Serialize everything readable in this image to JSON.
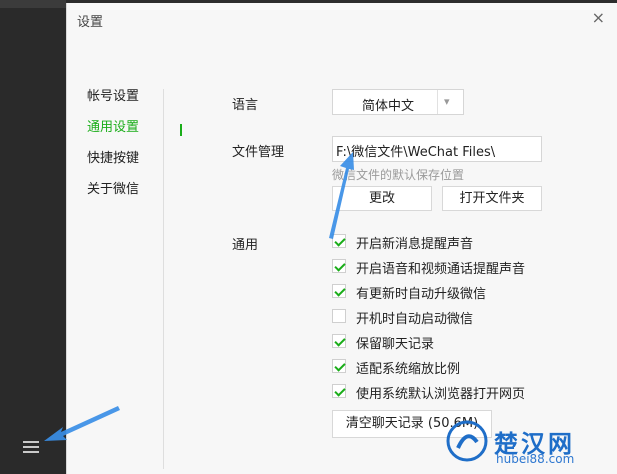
{
  "window": {
    "title": "设置",
    "close_glyph": "×"
  },
  "nav": {
    "items": [
      {
        "label": "帐号设置"
      },
      {
        "label": "通用设置"
      },
      {
        "label": "快捷按键"
      },
      {
        "label": "关于微信"
      }
    ],
    "active_color": "#1aad19"
  },
  "language": {
    "label": "语言",
    "value": "简体中文",
    "dropdown_glyph": "▾"
  },
  "file_manage": {
    "label": "文件管理",
    "path": "F:\\微信文件\\WeChat Files\\",
    "hint": "微信文件的默认保存位置",
    "change_label": "更改",
    "open_folder_label": "打开文件夹"
  },
  "general": {
    "label": "通用",
    "checks": [
      {
        "label": "开启新消息提醒声音",
        "checked": true
      },
      {
        "label": "开启语音和视频通话提醒声音",
        "checked": true
      },
      {
        "label": "有更新时自动升级微信",
        "checked": true
      },
      {
        "label": "开机时自动启动微信",
        "checked": false
      },
      {
        "label": "保留聊天记录",
        "checked": true
      },
      {
        "label": "适配系统缩放比例",
        "checked": true
      },
      {
        "label": "使用系统默认浏览器打开网页",
        "checked": true
      }
    ],
    "clear_label": "清空聊天记录 (50.6M)"
  },
  "watermark": {
    "text": "楚汉网",
    "sub": "hubei88.com"
  },
  "colors": {
    "arrow": "#3a8ee6",
    "watermark": "#1f6ec8"
  }
}
